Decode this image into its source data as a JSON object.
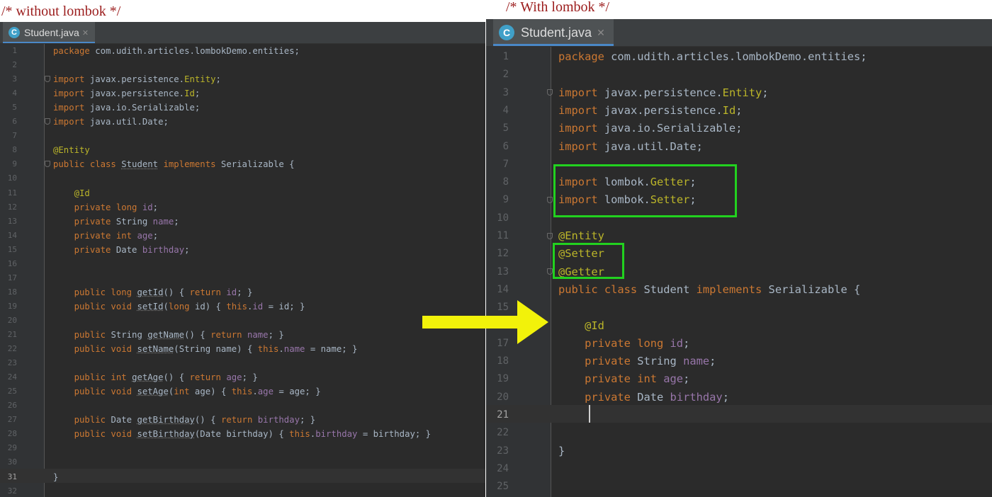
{
  "captions": {
    "left": "/* without lombok */",
    "right": "/* With lombok */"
  },
  "left_editor": {
    "tab": {
      "icon": "class-c-icon",
      "title": "Student.java",
      "close": "✕"
    },
    "current_line": 31,
    "lines": [
      {
        "n": "1",
        "t": [
          [
            "kw",
            "package "
          ],
          [
            "d",
            "com.udith.articles.lombokDemo.entities;"
          ]
        ]
      },
      {
        "n": "2",
        "t": []
      },
      {
        "n": "3",
        "t": [
          [
            "kw",
            "import "
          ],
          [
            "d",
            "javax.persistence."
          ],
          [
            "an",
            "Entity"
          ],
          [
            "d",
            ";"
          ]
        ]
      },
      {
        "n": "4",
        "t": [
          [
            "kw",
            "import "
          ],
          [
            "d",
            "javax.persistence."
          ],
          [
            "an",
            "Id"
          ],
          [
            "d",
            ";"
          ]
        ]
      },
      {
        "n": "5",
        "t": [
          [
            "kw",
            "import "
          ],
          [
            "d",
            "java.io.Serializable;"
          ]
        ]
      },
      {
        "n": "6",
        "t": [
          [
            "kw",
            "import "
          ],
          [
            "d",
            "java.util.Date;"
          ]
        ]
      },
      {
        "n": "7",
        "t": []
      },
      {
        "n": "8",
        "t": [
          [
            "an",
            "@Entity"
          ]
        ]
      },
      {
        "n": "9",
        "t": [
          [
            "kw",
            "public class "
          ],
          [
            "u",
            "Student"
          ],
          [
            "d",
            " "
          ],
          [
            "kw",
            "implements "
          ],
          [
            "d",
            "Serializable {"
          ]
        ]
      },
      {
        "n": "10",
        "t": []
      },
      {
        "n": "11",
        "t": [
          [
            "an",
            "    @Id"
          ]
        ]
      },
      {
        "n": "12",
        "t": [
          [
            "kw",
            "    private long "
          ],
          [
            "fd",
            "id"
          ],
          [
            "d",
            ";"
          ]
        ]
      },
      {
        "n": "13",
        "t": [
          [
            "kw",
            "    private "
          ],
          [
            "d",
            "String "
          ],
          [
            "fd",
            "name"
          ],
          [
            "d",
            ";"
          ]
        ]
      },
      {
        "n": "14",
        "t": [
          [
            "kw",
            "    private int "
          ],
          [
            "fd",
            "age"
          ],
          [
            "d",
            ";"
          ]
        ]
      },
      {
        "n": "15",
        "t": [
          [
            "kw",
            "    private "
          ],
          [
            "d",
            "Date "
          ],
          [
            "fd",
            "birthday"
          ],
          [
            "d",
            ";"
          ]
        ]
      },
      {
        "n": "16",
        "t": []
      },
      {
        "n": "17",
        "t": []
      },
      {
        "n": "18",
        "t": [
          [
            "kw",
            "    public long "
          ],
          [
            "u",
            "getId"
          ],
          [
            "d",
            "() { "
          ],
          [
            "kw",
            "return "
          ],
          [
            "fd",
            "id"
          ],
          [
            "d",
            "; }"
          ]
        ]
      },
      {
        "n": "19",
        "t": [
          [
            "kw",
            "    public void "
          ],
          [
            "u",
            "setId"
          ],
          [
            "d",
            "("
          ],
          [
            "kw",
            "long "
          ],
          [
            "d",
            "id) { "
          ],
          [
            "kw",
            "this"
          ],
          [
            "d",
            "."
          ],
          [
            "fd",
            "id"
          ],
          [
            "d",
            " = id; }"
          ]
        ]
      },
      {
        "n": "20",
        "t": []
      },
      {
        "n": "21",
        "t": [
          [
            "kw",
            "    public "
          ],
          [
            "d",
            "String "
          ],
          [
            "u",
            "getName"
          ],
          [
            "d",
            "() { "
          ],
          [
            "kw",
            "return "
          ],
          [
            "fd",
            "name"
          ],
          [
            "d",
            "; }"
          ]
        ]
      },
      {
        "n": "22",
        "t": [
          [
            "kw",
            "    public void "
          ],
          [
            "u",
            "setName"
          ],
          [
            "d",
            "(String name) { "
          ],
          [
            "kw",
            "this"
          ],
          [
            "d",
            "."
          ],
          [
            "fd",
            "name"
          ],
          [
            "d",
            " = name; }"
          ]
        ]
      },
      {
        "n": "23",
        "t": []
      },
      {
        "n": "24",
        "t": [
          [
            "kw",
            "    public int "
          ],
          [
            "u",
            "getAge"
          ],
          [
            "d",
            "() { "
          ],
          [
            "kw",
            "return "
          ],
          [
            "fd",
            "age"
          ],
          [
            "d",
            "; }"
          ]
        ]
      },
      {
        "n": "25",
        "t": [
          [
            "kw",
            "    public void "
          ],
          [
            "u",
            "setAge"
          ],
          [
            "d",
            "("
          ],
          [
            "kw",
            "int "
          ],
          [
            "d",
            "age) { "
          ],
          [
            "kw",
            "this"
          ],
          [
            "d",
            "."
          ],
          [
            "fd",
            "age"
          ],
          [
            "d",
            " = age; }"
          ]
        ]
      },
      {
        "n": "26",
        "t": []
      },
      {
        "n": "27",
        "t": [
          [
            "kw",
            "    public "
          ],
          [
            "d",
            "Date "
          ],
          [
            "u",
            "getBirthday"
          ],
          [
            "d",
            "() { "
          ],
          [
            "kw",
            "return "
          ],
          [
            "fd",
            "birthday"
          ],
          [
            "d",
            "; }"
          ]
        ]
      },
      {
        "n": "28",
        "t": [
          [
            "kw",
            "    public void "
          ],
          [
            "u",
            "setBirthday"
          ],
          [
            "d",
            "(Date birthday) { "
          ],
          [
            "kw",
            "this"
          ],
          [
            "d",
            "."
          ],
          [
            "fd",
            "birthday"
          ],
          [
            "d",
            " = birthday; }"
          ]
        ]
      },
      {
        "n": "29",
        "t": []
      },
      {
        "n": "30",
        "t": []
      },
      {
        "n": "31",
        "t": [
          [
            "d",
            "}"
          ]
        ]
      },
      {
        "n": "32",
        "t": []
      }
    ]
  },
  "right_editor": {
    "tab": {
      "icon": "class-c-icon",
      "title": "Student.java",
      "close": "✕"
    },
    "current_line": 21,
    "lines": [
      {
        "n": "1",
        "t": [
          [
            "kw",
            "package "
          ],
          [
            "d",
            "com.udith.articles.lombokDemo.entities;"
          ]
        ]
      },
      {
        "n": "2",
        "t": []
      },
      {
        "n": "3",
        "t": [
          [
            "kw",
            "import "
          ],
          [
            "d",
            "javax.persistence."
          ],
          [
            "an",
            "Entity"
          ],
          [
            "d",
            ";"
          ]
        ]
      },
      {
        "n": "4",
        "t": [
          [
            "kw",
            "import "
          ],
          [
            "d",
            "javax.persistence."
          ],
          [
            "an",
            "Id"
          ],
          [
            "d",
            ";"
          ]
        ]
      },
      {
        "n": "5",
        "t": [
          [
            "kw",
            "import "
          ],
          [
            "d",
            "java.io.Serializable;"
          ]
        ]
      },
      {
        "n": "6",
        "t": [
          [
            "kw",
            "import "
          ],
          [
            "d",
            "java.util.Date;"
          ]
        ]
      },
      {
        "n": "7",
        "t": []
      },
      {
        "n": "8",
        "t": [
          [
            "kw",
            "import "
          ],
          [
            "d",
            "lombok."
          ],
          [
            "an",
            "Getter"
          ],
          [
            "d",
            ";"
          ]
        ]
      },
      {
        "n": "9",
        "t": [
          [
            "kw",
            "import "
          ],
          [
            "d",
            "lombok."
          ],
          [
            "an",
            "Setter"
          ],
          [
            "d",
            ";"
          ]
        ]
      },
      {
        "n": "10",
        "t": []
      },
      {
        "n": "11",
        "t": [
          [
            "an",
            "@Entity"
          ]
        ]
      },
      {
        "n": "12",
        "t": [
          [
            "an",
            "@Setter"
          ]
        ]
      },
      {
        "n": "13",
        "t": [
          [
            "an",
            "@Getter"
          ]
        ]
      },
      {
        "n": "14",
        "t": [
          [
            "kw",
            "public class "
          ],
          [
            "d",
            "Student "
          ],
          [
            "kw",
            "implements "
          ],
          [
            "d",
            "Serializable {"
          ]
        ]
      },
      {
        "n": "15",
        "t": []
      },
      {
        "n": "16",
        "t": [
          [
            "an",
            "    @Id"
          ]
        ]
      },
      {
        "n": "17",
        "t": [
          [
            "kw",
            "    private long "
          ],
          [
            "fd",
            "id"
          ],
          [
            "d",
            ";"
          ]
        ]
      },
      {
        "n": "18",
        "t": [
          [
            "kw",
            "    private "
          ],
          [
            "d",
            "String "
          ],
          [
            "fd",
            "name"
          ],
          [
            "d",
            ";"
          ]
        ]
      },
      {
        "n": "19",
        "t": [
          [
            "kw",
            "    private int "
          ],
          [
            "fd",
            "age"
          ],
          [
            "d",
            ";"
          ]
        ]
      },
      {
        "n": "20",
        "t": [
          [
            "kw",
            "    private "
          ],
          [
            "d",
            "Date "
          ],
          [
            "fd",
            "birthday"
          ],
          [
            "d",
            ";"
          ]
        ]
      },
      {
        "n": "21",
        "t": []
      },
      {
        "n": "22",
        "t": []
      },
      {
        "n": "23",
        "t": [
          [
            "d",
            "}"
          ]
        ]
      },
      {
        "n": "24",
        "t": []
      },
      {
        "n": "25",
        "t": []
      }
    ]
  },
  "colors": {
    "keyword": "#cc7832",
    "annotation": "#bbb529",
    "field": "#9876aa",
    "text": "#a9b7c6",
    "highlight_box": "#22d11f",
    "arrow": "#f2f20a"
  }
}
